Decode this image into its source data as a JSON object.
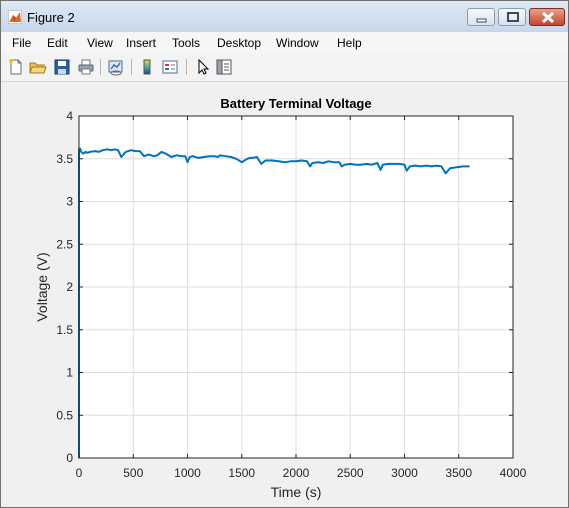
{
  "window": {
    "title": "Figure 2",
    "icon": "matlab-icon"
  },
  "menu": [
    "File",
    "Edit",
    "View",
    "Insert",
    "Tools",
    "Desktop",
    "Window",
    "Help"
  ],
  "toolbar_icons": [
    "new-figure-icon",
    "open-file-icon",
    "save-icon",
    "print-icon",
    "link-plot-icon",
    "colorbar-icon",
    "legend-icon",
    "edit-plot-arrow-icon",
    "property-inspector-icon"
  ],
  "colors": {
    "series": "#0072bd",
    "title_bar": "#c6d6ea",
    "close_button": "#c7442c"
  },
  "chart_data": {
    "type": "line",
    "title": "Battery Terminal Voltage",
    "xlabel": "Time (s)",
    "ylabel": "Voltage (V)",
    "xlim": [
      0,
      4000
    ],
    "ylim": [
      0,
      4
    ],
    "xticks": [
      0,
      500,
      1000,
      1500,
      2000,
      2500,
      3000,
      3500,
      4000
    ],
    "yticks": [
      0,
      0.5,
      1,
      1.5,
      2,
      2.5,
      3,
      3.5,
      4
    ],
    "grid": true,
    "series": [
      {
        "color": "#0072bd",
        "x": [
          0,
          0,
          10,
          20,
          40,
          60,
          80,
          100,
          150,
          180,
          220,
          260,
          300,
          330,
          360,
          390,
          430,
          480,
          520,
          560,
          600,
          640,
          690,
          720,
          760,
          800,
          850,
          900,
          940,
          980,
          1000,
          1020,
          1050,
          1100,
          1150,
          1200,
          1250,
          1280,
          1300,
          1350,
          1400,
          1450,
          1500,
          1550,
          1580,
          1600,
          1640,
          1680,
          1720,
          1780,
          1840,
          1900,
          1950,
          2000,
          2050,
          2100,
          2130,
          2150,
          2200,
          2250,
          2300,
          2350,
          2400,
          2420,
          2450,
          2500,
          2550,
          2600,
          2650,
          2700,
          2750,
          2780,
          2800,
          2850,
          2900,
          2950,
          3000,
          3020,
          3050,
          3100,
          3150,
          3200,
          3250,
          3300,
          3340,
          3380,
          3420,
          3480,
          3540,
          3600
        ],
        "y": [
          0,
          3.61,
          3.62,
          3.58,
          3.56,
          3.58,
          3.57,
          3.58,
          3.59,
          3.58,
          3.6,
          3.61,
          3.6,
          3.61,
          3.6,
          3.52,
          3.58,
          3.6,
          3.59,
          3.59,
          3.53,
          3.55,
          3.53,
          3.54,
          3.58,
          3.56,
          3.52,
          3.54,
          3.53,
          3.53,
          3.46,
          3.52,
          3.53,
          3.51,
          3.52,
          3.53,
          3.53,
          3.52,
          3.54,
          3.53,
          3.52,
          3.5,
          3.46,
          3.5,
          3.51,
          3.51,
          3.52,
          3.44,
          3.48,
          3.48,
          3.47,
          3.46,
          3.47,
          3.47,
          3.48,
          3.47,
          3.41,
          3.45,
          3.46,
          3.45,
          3.47,
          3.46,
          3.46,
          3.41,
          3.43,
          3.44,
          3.43,
          3.43,
          3.44,
          3.43,
          3.45,
          3.37,
          3.43,
          3.44,
          3.44,
          3.44,
          3.43,
          3.36,
          3.41,
          3.42,
          3.41,
          3.42,
          3.41,
          3.42,
          3.41,
          3.33,
          3.39,
          3.4,
          3.41,
          3.41
        ]
      }
    ]
  }
}
